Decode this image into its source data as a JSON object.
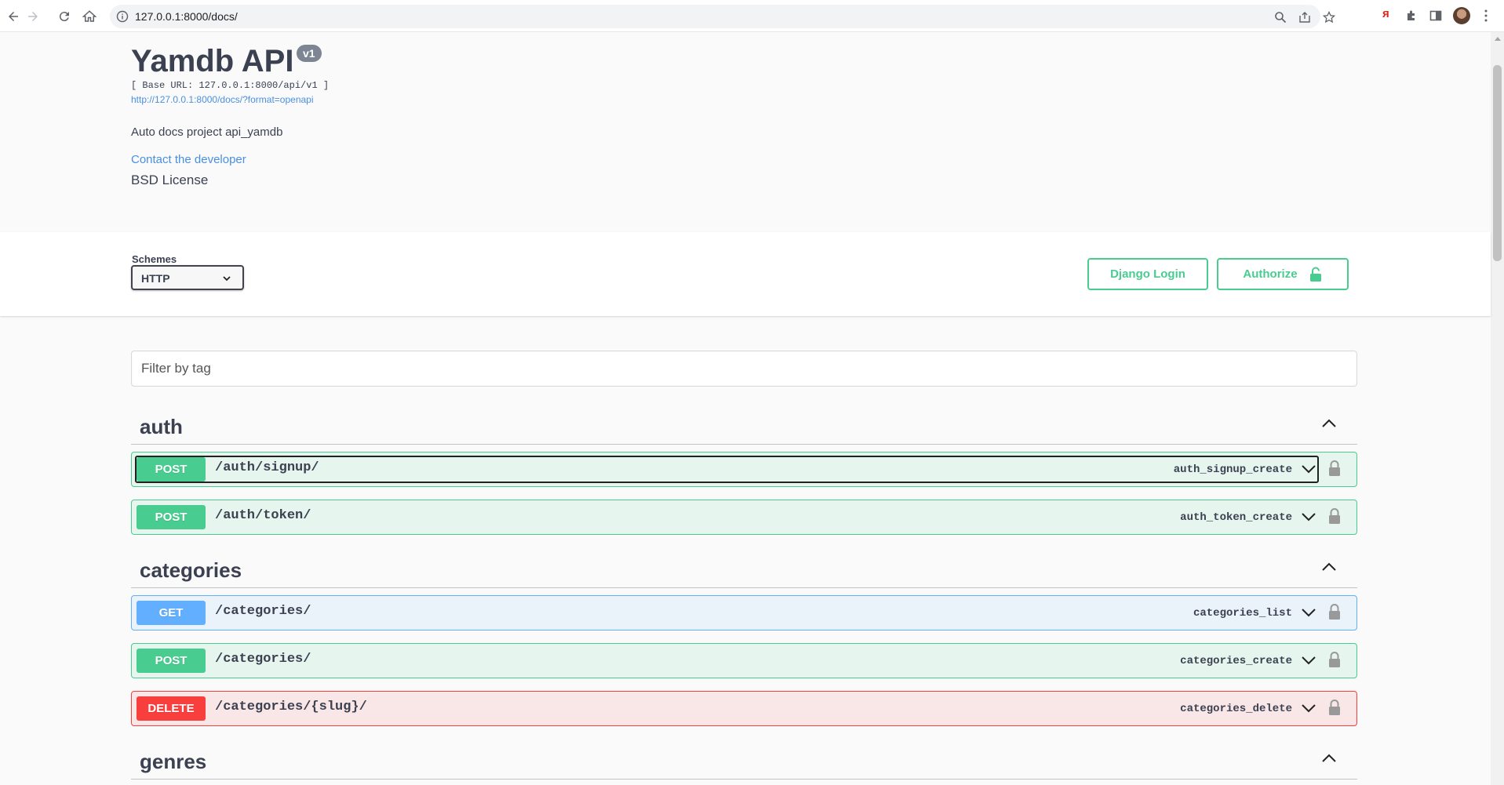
{
  "browser": {
    "url": "127.0.0.1:8000/docs/"
  },
  "info": {
    "title": "Yamdb API",
    "version": "v1",
    "base_url": "[ Base URL: 127.0.0.1:8000/api/v1 ]",
    "spec_link": "http://127.0.0.1:8000/docs/?format=openapi",
    "description": "Auto docs project api_yamdb",
    "contact_link": "Contact the developer",
    "license": "BSD License"
  },
  "schemes": {
    "label": "Schemes",
    "selected": "HTTP"
  },
  "auth_buttons": {
    "django_login": "Django Login",
    "authorize": "Authorize"
  },
  "filter": {
    "placeholder": "Filter by tag"
  },
  "tags": [
    {
      "name": "auth",
      "operations": [
        {
          "method": "POST",
          "path": "/auth/signup/",
          "operation_id": "auth_signup_create"
        },
        {
          "method": "POST",
          "path": "/auth/token/",
          "operation_id": "auth_token_create"
        }
      ]
    },
    {
      "name": "categories",
      "operations": [
        {
          "method": "GET",
          "path": "/categories/",
          "operation_id": "categories_list"
        },
        {
          "method": "POST",
          "path": "/categories/",
          "operation_id": "categories_create"
        },
        {
          "method": "DELETE",
          "path": "/categories/{slug}/",
          "operation_id": "categories_delete"
        }
      ]
    },
    {
      "name": "genres",
      "operations": []
    }
  ],
  "colors": {
    "post": "#49cc90",
    "get": "#61affe",
    "delete": "#f93e3e",
    "link": "#4990e2",
    "text": "#3b4151"
  }
}
